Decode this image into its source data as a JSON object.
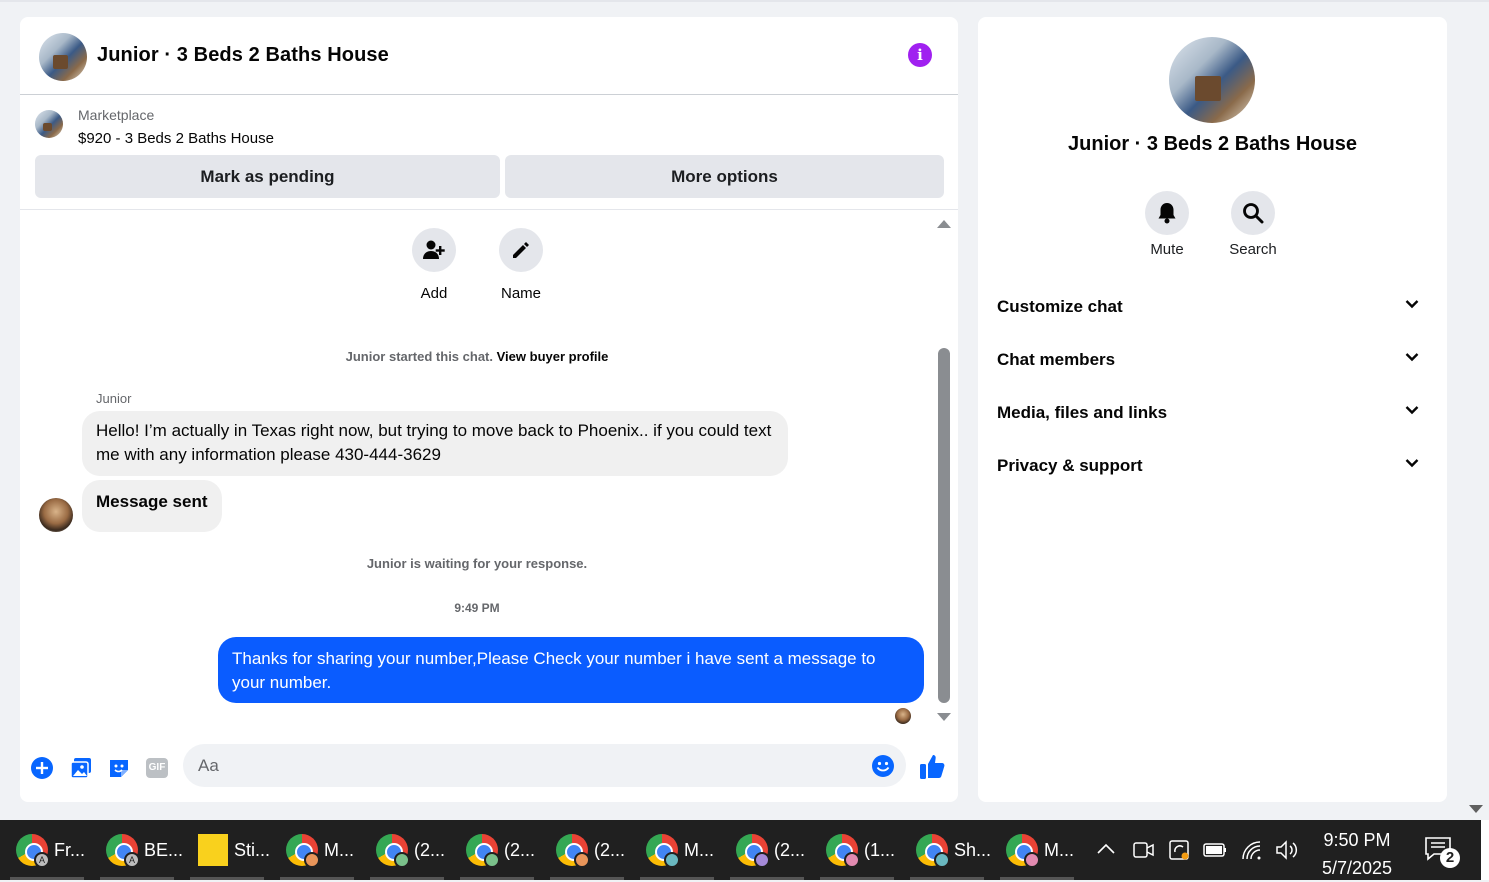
{
  "chat": {
    "title": "Junior · 3 Beds 2 Baths House",
    "marketplace_label": "Marketplace",
    "listing": "$920 - 3 Beds 2 Baths House",
    "mark_pending": "Mark as pending",
    "more_options": "More options",
    "actions": {
      "add": "Add",
      "name": "Name"
    },
    "started_prefix": "Junior started this chat.",
    "view_buyer_profile": "View buyer profile",
    "sender_name": "Junior",
    "incoming_message": "Hello! I’m actually in Texas right now, but trying to move back to Phoenix.. if you could text me with any information please 430-444-3629",
    "message_sent": "Message sent",
    "waiting": "Junior is waiting for your response.",
    "timestamp": "9:49 PM",
    "outgoing_message": "Thanks for sharing your number,Please Check your number i have sent a message to your number.",
    "composer_placeholder": "Aa",
    "gif_label": "GIF",
    "info_glyph": "i"
  },
  "side": {
    "title": "Junior · 3 Beds 2 Baths House",
    "mute": "Mute",
    "search": "Search",
    "sections": [
      "Customize chat",
      "Chat members",
      "Media, files and links",
      "Privacy & support"
    ]
  },
  "taskbar": {
    "apps": [
      {
        "label": "Fr...",
        "icon": "chrome-icon",
        "badge": "A"
      },
      {
        "label": "BE...",
        "icon": "chrome-icon",
        "badge": "A"
      },
      {
        "label": "Sti...",
        "icon": "sticky-notes-icon",
        "badge": ""
      },
      {
        "label": "M...",
        "icon": "chrome-icon",
        "badge": "orange"
      },
      {
        "label": "(2...",
        "icon": "chrome-icon",
        "badge": "green"
      },
      {
        "label": "(2...",
        "icon": "chrome-icon",
        "badge": "green"
      },
      {
        "label": "(2...",
        "icon": "chrome-icon",
        "badge": "orange"
      },
      {
        "label": "M...",
        "icon": "chrome-icon",
        "badge": "teal"
      },
      {
        "label": "(2...",
        "icon": "chrome-icon",
        "badge": "purple"
      },
      {
        "label": "(1...",
        "icon": "chrome-icon",
        "badge": "pink"
      },
      {
        "label": "Sh...",
        "icon": "chrome-icon",
        "badge": "teal"
      },
      {
        "label": "M...",
        "icon": "chrome-icon",
        "badge": "pink"
      }
    ],
    "time": "9:50 PM",
    "date": "5/7/2025",
    "notifications": "2"
  },
  "colors": {
    "accent": "#0a5cff",
    "info": "#a020f0",
    "icon_blue": "#0866ff"
  }
}
